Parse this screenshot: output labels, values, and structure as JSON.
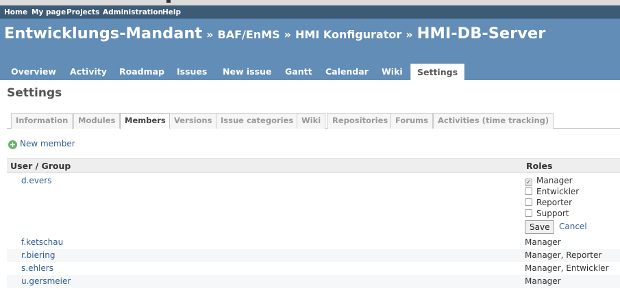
{
  "top_menu": [
    "Home",
    "My page",
    "Projects",
    "Administration",
    "Help"
  ],
  "header": {
    "breadcrumb": [
      "Entwicklungs-Mandant",
      "BAF/EnMS",
      "HMI Konfigurator"
    ],
    "separator": "»",
    "project": "HMI-DB-Server"
  },
  "main_tabs": [
    "Overview",
    "Activity",
    "Roadmap",
    "Issues",
    "New issue",
    "Gantt",
    "Calendar",
    "Wiki",
    "Settings"
  ],
  "page_title": "Settings",
  "settings_tabs": [
    "Information",
    "Modules",
    "Members",
    "Versions",
    "Issue categories",
    "Wiki",
    "Repositories",
    "Forums",
    "Activities (time tracking)"
  ],
  "new_member": "New member",
  "table": {
    "col_user": "User / Group",
    "col_roles": "Roles",
    "editing_user": "d.evers",
    "role_options": [
      {
        "label": "Manager",
        "checked": true
      },
      {
        "label": "Entwickler",
        "checked": false
      },
      {
        "label": "Reporter",
        "checked": false
      },
      {
        "label": "Support",
        "checked": false
      }
    ],
    "save_label": "Save",
    "cancel_label": "Cancel",
    "rows": [
      {
        "user": "f.ketschau",
        "roles": "Manager"
      },
      {
        "user": "r.biering",
        "roles": "Manager, Reporter"
      },
      {
        "user": "s.ehlers",
        "roles": "Manager, Entwickler"
      },
      {
        "user": "u.gersmeier",
        "roles": "Manager"
      }
    ]
  },
  "colors": {
    "top_menu_bg": "#3e5b76",
    "header_bg": "#628db6",
    "link": "#2f5f93"
  }
}
